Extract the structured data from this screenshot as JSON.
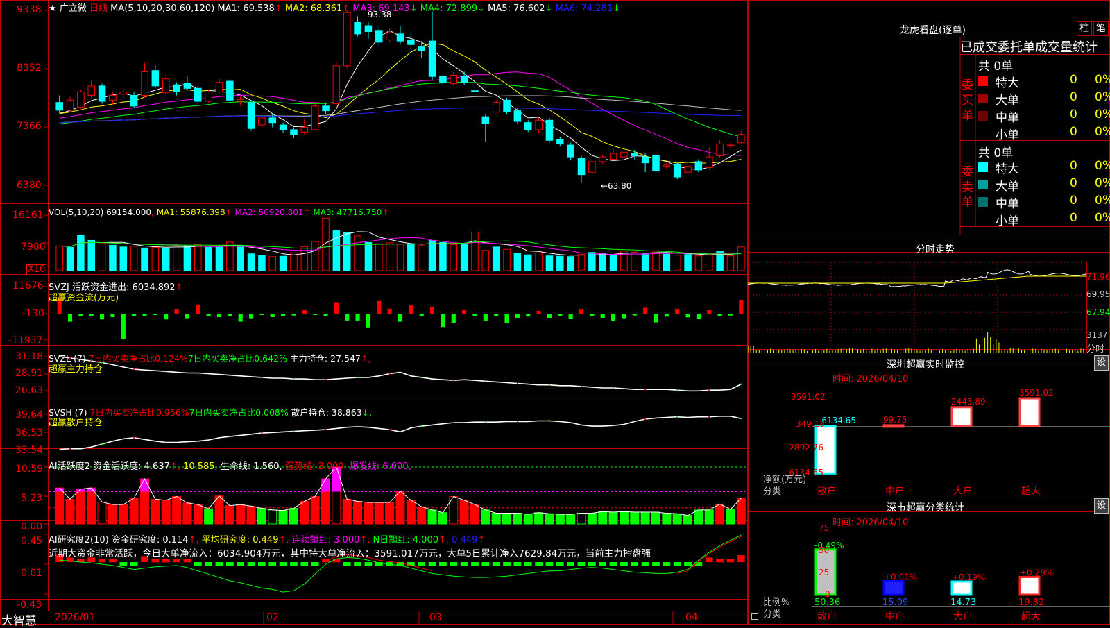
{
  "stock": {
    "star": "★",
    "name": "广立微",
    "period": "日线"
  },
  "colors": {
    "grid": "#8b0000",
    "panel_border": "#c00000",
    "up": "#ff0000",
    "down": "#00ffff",
    "white": "#ffffff",
    "yellow": "#ffff00",
    "magenta": "#ff00ff",
    "green": "#00ff00",
    "blue": "#2020ff",
    "gray": "#c0c0c0"
  },
  "price_panel": {
    "ma_header": "MA(5,10,20,30,60,120)",
    "ma": [
      {
        "label": "MA1: 69.538",
        "arrow": "↑",
        "color": "#ffffff"
      },
      {
        "label": "MA2: 68.361",
        "arrow": "↑",
        "color": "#ffff00"
      },
      {
        "label": "MA3: 69.143",
        "arrow": "↓",
        "color": "#ff00ff"
      },
      {
        "label": "MA4: 72.899",
        "arrow": "↓",
        "color": "#00ff00"
      },
      {
        "label": "MA5: 76.602",
        "arrow": "↓",
        "color": "#ffffff"
      },
      {
        "label": "MA6: 74.281",
        "arrow": "↓",
        "color": "#2020ff"
      }
    ],
    "y_ticks": [
      "9338",
      "8352",
      "7366",
      "6380"
    ],
    "high_label": "93.38",
    "low_label": "←63.80"
  },
  "vol_panel": {
    "header": "VOL(5,10,20)",
    "value": "69154.000",
    "ma": [
      {
        "label": "MA1: 55876.398",
        "arrow": "↑",
        "color": "#ffffff"
      },
      {
        "label": "MA2: 50920.801",
        "arrow": "↑",
        "color": "#ff00ff"
      },
      {
        "label": "MA3: 47716.750",
        "arrow": "↑",
        "color": "#00ff00"
      }
    ],
    "y_ticks": [
      "16161",
      "7980"
    ],
    "unit": "X10"
  },
  "svzj_panel": {
    "name": "SVZJ",
    "label": "活跃资金进出: 6034.892",
    "arrow": "↑",
    "subtitle": "超赢资金流(万元)",
    "y_ticks": [
      "11676",
      "-130",
      "-11937"
    ]
  },
  "svzl_panel": {
    "name": "SVZL (7)",
    "t1": "7日内买卖净占比0.124%",
    "t2": "7日内买卖净占比0.642%",
    "t3": "主力持仓: 27.547",
    "arrow": "↑,",
    "subtitle": "超赢主力持仓",
    "y_ticks": [
      "31.18",
      "28.91",
      "26.63"
    ]
  },
  "svsh_panel": {
    "name": "SVSH (7)",
    "t1": "7日内买卖净占比0.956%",
    "t2": "7日内买卖净占比0.008%",
    "t3": "散户持仓: 38.863",
    "arrow": "↓,",
    "subtitle": "超赢散户持仓",
    "y_ticks": [
      "39.64",
      "36.53",
      "33.54"
    ]
  },
  "ai_panel": {
    "t0": "AI活跃度2",
    "t1": "资金活跃度: 4.637",
    "t2": "10.585",
    "t3": "生命线: 1.560",
    "t4": "强势线: 3.000",
    "t5": "爆发线: 6.000",
    "y_ticks": [
      "10.59",
      "5.23",
      "0.00"
    ]
  },
  "research_panel": {
    "t0": "AI研究度2(10)",
    "t1": "资金研究度: 0.114",
    "t2": "平均研究度: 0.449",
    "t3": "连续飘红: 3.000",
    "t4": "N日飘红: 4.000",
    "t5": "0.449",
    "comment": "近期大资金非常活跃，今日大单净流入：6034.904万元，其中特大单净流入：3591.017万元，大单5日累计净入7629.84万元，当前主力控盘强",
    "y_ticks": [
      "0.45",
      "0.01",
      "-0.43"
    ]
  },
  "bottom_bar": {
    "logo": "大智慧",
    "dates": [
      "2026/01",
      "02",
      "03",
      "04"
    ]
  },
  "right_panel": {
    "title": "龙虎看盘(逐单)",
    "btn_zhu": "柱",
    "btn_bi": "笔",
    "table_title": "已成交委托单成交量统计",
    "buy_label": "委买单",
    "sell_label": "委卖单",
    "buy_total": "共 0单",
    "sell_total": "共 0单",
    "rows": [
      {
        "name": "特大",
        "count": "0",
        "pct": "0%"
      },
      {
        "name": "大单",
        "count": "0",
        "pct": "0%"
      },
      {
        "name": "中单",
        "count": "0",
        "pct": "0%"
      },
      {
        "name": "小单",
        "count": "0",
        "pct": "0%"
      }
    ],
    "buy_colors": [
      "#ff0000",
      "#a00000",
      "#700000",
      "#000000"
    ],
    "sell_colors": [
      "#00ffff",
      "#00a0a0",
      "#007070",
      "#000000"
    ],
    "intraday_title": "分时走势",
    "intraday_ticks": [
      "71.96",
      "69.95",
      "67.94",
      "3137"
    ],
    "intraday_unit": "分时",
    "monitor_title": "深圳超赢实时监控",
    "monitor_btn": "设",
    "monitor_time": "时间: 2026/04/10",
    "monitor_ticks": [
      "3591.02",
      "349.18",
      "-2892.76",
      "-6134.65"
    ],
    "monitor_ylabel": "净额(万元)",
    "monitor_xlabel": "分类",
    "monitor_categories": [
      "散户",
      "中户",
      "大户",
      "超大"
    ],
    "monitor_values": [
      "-6134.65",
      "99.75",
      "2443.89",
      "3591.02"
    ],
    "classify_title": "深市超赢分类统计",
    "classify_btn": "设",
    "classify_time": "时间: 2026/04/10",
    "classify_ticks": [
      "75",
      "50",
      "25",
      "0"
    ],
    "classify_ylabel": "比例%",
    "classify_xlabel": "分类",
    "classify_categories": [
      "散户",
      "中户",
      "大户",
      "超大"
    ],
    "classify_values": [
      "50.36",
      "15.09",
      "14.73",
      "19.82"
    ],
    "classify_changes": [
      "-0.49%",
      "+0.01%",
      "+0.19%",
      "+0.28%"
    ]
  },
  "chart_data": [
    {
      "type": "candlestick",
      "title": "广立微 日线",
      "y_ticks": [
        93.38,
        83.52,
        73.66,
        63.8
      ],
      "high": 93.38,
      "low": 63.8,
      "candles": [
        [
          77.8,
          76.5,
          79.0,
          76.0
        ],
        [
          76.5,
          78.2,
          78.8,
          76.2
        ],
        [
          77.0,
          79.6,
          80.0,
          76.8
        ],
        [
          79.0,
          80.6,
          81.5,
          78.5
        ],
        [
          80.6,
          78.0,
          81.0,
          77.6
        ],
        [
          78.2,
          79.0,
          79.5,
          77.5
        ],
        [
          79.2,
          79.6,
          80.2,
          78.4
        ],
        [
          79.0,
          77.2,
          79.6,
          76.8
        ],
        [
          79.0,
          83.0,
          84.5,
          78.6
        ],
        [
          83.2,
          80.6,
          84.2,
          80.2
        ],
        [
          79.5,
          81.8,
          82.5,
          79.0
        ],
        [
          80.8,
          79.6,
          81.2,
          79.0
        ],
        [
          81.0,
          80.2,
          82.2,
          79.8
        ],
        [
          80.2,
          78.0,
          80.6,
          77.6
        ],
        [
          78.0,
          79.6,
          80.0,
          77.8
        ],
        [
          79.6,
          81.2,
          82.0,
          79.2
        ],
        [
          81.4,
          78.2,
          81.8,
          77.8
        ],
        [
          78.0,
          78.3,
          78.8,
          77.2
        ],
        [
          77.8,
          73.4,
          78.2,
          73.0
        ],
        [
          74.0,
          75.2,
          75.8,
          73.8
        ],
        [
          75.2,
          74.4,
          75.8,
          73.6
        ],
        [
          74.0,
          73.2,
          74.4,
          72.6
        ],
        [
          73.2,
          72.4,
          73.6,
          71.8
        ],
        [
          72.8,
          73.6,
          75.0,
          72.4
        ],
        [
          73.2,
          77.2,
          77.8,
          73.0
        ],
        [
          77.2,
          76.4,
          77.8,
          75.8
        ],
        [
          77.6,
          84.0,
          84.6,
          77.2
        ],
        [
          84.0,
          93.0,
          93.4,
          83.6
        ],
        [
          91.4,
          89.4,
          92.4,
          89.0
        ],
        [
          90.8,
          89.8,
          91.4,
          88.6
        ],
        [
          90.0,
          88.0,
          90.8,
          87.4
        ],
        [
          88.4,
          89.6,
          90.4,
          88.0
        ],
        [
          89.4,
          88.2,
          90.8,
          87.6
        ],
        [
          88.4,
          87.6,
          89.8,
          86.8
        ],
        [
          87.2,
          86.6,
          88.2,
          85.4
        ],
        [
          88.2,
          82.2,
          93.2,
          81.6
        ],
        [
          82.2,
          81.2,
          82.6,
          80.6
        ],
        [
          81.0,
          82.4,
          83.0,
          80.6
        ],
        [
          82.2,
          81.2,
          83.0,
          80.8
        ],
        [
          79.8,
          79.6,
          80.4,
          79.0
        ],
        [
          75.4,
          74.2,
          75.8,
          71.2
        ],
        [
          76.2,
          77.8,
          78.2,
          76.0
        ],
        [
          78.2,
          76.2,
          78.6,
          75.8
        ],
        [
          76.4,
          74.6,
          76.8,
          74.2
        ],
        [
          74.4,
          73.2,
          74.8,
          72.8
        ],
        [
          73.2,
          74.8,
          75.2,
          72.6
        ],
        [
          74.8,
          71.4,
          75.2,
          71.0
        ],
        [
          71.6,
          70.8,
          72.0,
          70.4
        ],
        [
          70.6,
          68.6,
          71.0,
          68.0
        ],
        [
          68.4,
          65.6,
          68.8,
          64.2
        ],
        [
          66.0,
          67.8,
          68.2,
          65.8
        ],
        [
          67.8,
          68.6,
          69.0,
          67.4
        ],
        [
          68.2,
          69.2,
          70.0,
          67.8
        ],
        [
          68.6,
          69.4,
          70.2,
          68.0
        ],
        [
          69.2,
          68.8,
          69.8,
          68.2
        ],
        [
          68.6,
          67.6,
          69.2,
          66.0
        ],
        [
          68.8,
          66.2,
          69.2,
          65.8
        ],
        [
          67.0,
          67.2,
          67.6,
          66.6
        ],
        [
          67.4,
          65.2,
          67.8,
          64.8
        ],
        [
          66.0,
          67.0,
          67.4,
          65.6
        ],
        [
          67.8,
          66.4,
          68.2,
          66.0
        ],
        [
          66.8,
          68.6,
          70.2,
          66.4
        ],
        [
          68.8,
          70.8,
          71.4,
          68.4
        ],
        [
          70.6,
          70.6,
          71.0,
          70.0
        ],
        [
          71.0,
          72.4,
          73.0,
          70.8
        ]
      ]
    },
    {
      "type": "bar",
      "title": "VOL(5,10,20)",
      "y_ticks": [
        16161,
        7980
      ],
      "unit": "X10",
      "values": [
        7200,
        6800,
        10200,
        8800,
        7900,
        7400,
        6900,
        7100,
        6600,
        6800,
        6600,
        7300,
        7100,
        7700,
        6800,
        7000,
        8300,
        6900,
        4900,
        4400,
        4100,
        4200,
        5200,
        7000,
        8500,
        15300,
        11600,
        11200,
        10100,
        8200,
        7800,
        8100,
        7700,
        7600,
        7300,
        8800,
        8200,
        7600,
        7700,
        11200,
        5900,
        6900,
        6200,
        5100,
        4600,
        5200,
        4300,
        4200,
        4100,
        4800,
        5300,
        5000,
        4500,
        5700,
        5400,
        4900,
        5800,
        4800,
        4500,
        4700,
        4300,
        4500,
        5700,
        4300,
        6915
      ],
      "updown": [
        1,
        -1,
        -1,
        -1,
        1,
        -1,
        -1,
        1,
        -1,
        1,
        -1,
        1,
        -1,
        1,
        -1,
        -1,
        1,
        -1,
        -1,
        -1,
        1,
        -1,
        1,
        1,
        1,
        1,
        -1,
        -1,
        1,
        -1,
        1,
        1,
        1,
        -1,
        1,
        -1,
        -1,
        1,
        -1,
        1,
        1,
        -1,
        1,
        -1,
        -1,
        1,
        -1,
        -1,
        -1,
        1,
        -1,
        -1,
        -1,
        1,
        1,
        -1,
        1,
        -1,
        1,
        -1,
        1,
        1,
        -1,
        1,
        1
      ]
    },
    {
      "type": "bar",
      "title": "活跃资金进出",
      "y_ticks": [
        11676,
        -130,
        -11937
      ],
      "values": [
        7000,
        -3500,
        -1000,
        -1000,
        -2500,
        -1500,
        -11000,
        -1200,
        -1000,
        -600,
        -2500,
        2000,
        -2000,
        4000,
        -1200,
        -1500,
        -1000,
        -3500,
        -2000,
        -600,
        -1500,
        -1000,
        -800,
        1500,
        -500,
        -1000,
        5000,
        -3000,
        -3000,
        -6000,
        5500,
        2200,
        -3500,
        3600,
        -900,
        3000,
        -5800,
        -4000,
        1500,
        -1200,
        -3000,
        -1200,
        -4000,
        -1800,
        -1300,
        1200,
        -1800,
        -1000,
        -2300,
        1800,
        -1200,
        -1800,
        -3100,
        -2000,
        -800,
        2600,
        -3800,
        -1300,
        2000,
        -1600,
        -2300,
        1500,
        -1000,
        -800,
        6034.9
      ]
    },
    {
      "type": "line",
      "title": "超赢主力持仓",
      "y_ticks": [
        31.18,
        28.91,
        26.63
      ],
      "values": [
        31.2,
        31.0,
        30.8,
        30.6,
        30.4,
        30.1,
        29.8,
        29.5,
        29.4,
        29.3,
        29.2,
        29.1,
        29.0,
        29.0,
        28.9,
        28.8,
        28.7,
        28.6,
        28.5,
        28.4,
        28.3,
        28.3,
        28.2,
        28.2,
        28.1,
        28.1,
        28.2,
        28.3,
        28.4,
        28.4,
        28.6,
        28.9,
        29.1,
        28.6,
        28.4,
        28.2,
        28.1,
        28.0,
        28.1,
        28.0,
        27.9,
        27.8,
        27.7,
        27.6,
        27.5,
        27.4,
        27.4,
        27.3,
        27.3,
        27.2,
        27.1,
        27.0,
        27.0,
        26.9,
        26.8,
        26.8,
        26.8,
        26.8,
        26.7,
        26.6,
        26.6,
        26.7,
        26.7,
        26.8,
        27.5
      ]
    },
    {
      "type": "line",
      "title": "超赢散户持仓",
      "y_ticks": [
        39.64,
        36.53,
        33.54
      ],
      "values": [
        33.6,
        33.7,
        33.7,
        34.0,
        34.5,
        35.0,
        35.4,
        35.6,
        35.3,
        35.0,
        34.8,
        34.8,
        34.9,
        35.0,
        35.2,
        35.6,
        35.8,
        36.0,
        36.2,
        36.4,
        36.5,
        36.6,
        36.7,
        36.8,
        36.9,
        37.0,
        37.2,
        37.4,
        37.5,
        37.4,
        37.2,
        37.0,
        36.6,
        37.3,
        37.6,
        37.8,
        38.0,
        38.2,
        38.2,
        38.3,
        38.3,
        38.3,
        38.4,
        38.4,
        38.4,
        38.5,
        38.5,
        38.4,
        38.2,
        37.8,
        37.6,
        37.6,
        37.7,
        37.9,
        38.4,
        38.8,
        39.0,
        39.1,
        39.2,
        39.1,
        39.2,
        39.2,
        39.3,
        39.3,
        38.9
      ]
    },
    {
      "type": "bar",
      "title": "AI活跃度2",
      "y_ticks": [
        10.59,
        5.23,
        0.0
      ],
      "values": [
        6.7,
        4.6,
        6.5,
        6.7,
        4.1,
        3.6,
        3.6,
        4.8,
        8.4,
        4.6,
        4.4,
        5.1,
        3.9,
        3.6,
        2.8,
        5.2,
        3.4,
        3.6,
        3.3,
        2.9,
        2.6,
        2.5,
        2.9,
        4.2,
        5.1,
        8.4,
        10.6,
        4.6,
        4.2,
        4.0,
        4.0,
        4.0,
        6.1,
        4.4,
        3.2,
        2.6,
        2.1,
        5.1,
        4.4,
        3.6,
        2.6,
        2.0,
        2.0,
        2.0,
        1.8,
        2.1,
        1.9,
        1.8,
        1.8,
        2.0,
        2.0,
        2.3,
        2.2,
        2.3,
        2.2,
        2.2,
        2.2,
        2.0,
        1.9,
        1.6,
        2.6,
        2.6,
        3.7,
        2.7,
        4.8
      ],
      "lines": {
        "life": 1.56,
        "strong": 3.0,
        "burst": 6.0,
        "top": 10.585
      }
    },
    {
      "type": "bar",
      "title": "AI研究度2(10)",
      "y_ticks": [
        0.45,
        0.01,
        -0.43
      ],
      "values": [
        0.12,
        0.08,
        0.06,
        0.08,
        0.06,
        0.04,
        0.0,
        -0.01,
        0.1,
        0.06,
        0.05,
        0.06,
        0.03,
        0.0,
        -0.03,
        -0.02,
        -0.04,
        -0.06,
        -0.07,
        -0.08,
        -0.07,
        -0.05,
        -0.03,
        -0.01,
        0.02,
        0.03,
        0.06,
        0.0,
        0.01,
        0.0,
        -0.01,
        -0.03,
        -0.05,
        -0.06,
        -0.07,
        -0.06,
        -0.05,
        -0.04,
        -0.04,
        -0.03,
        -0.02,
        -0.02,
        -0.03,
        -0.04,
        -0.05,
        -0.04,
        -0.05,
        -0.05,
        -0.06,
        -0.05,
        -0.04,
        -0.05,
        -0.05,
        -0.04,
        -0.04,
        -0.05,
        -0.06,
        -0.06,
        -0.04,
        -0.03,
        0.02,
        0.08,
        0.06,
        0.06,
        0.114
      ]
    }
  ]
}
